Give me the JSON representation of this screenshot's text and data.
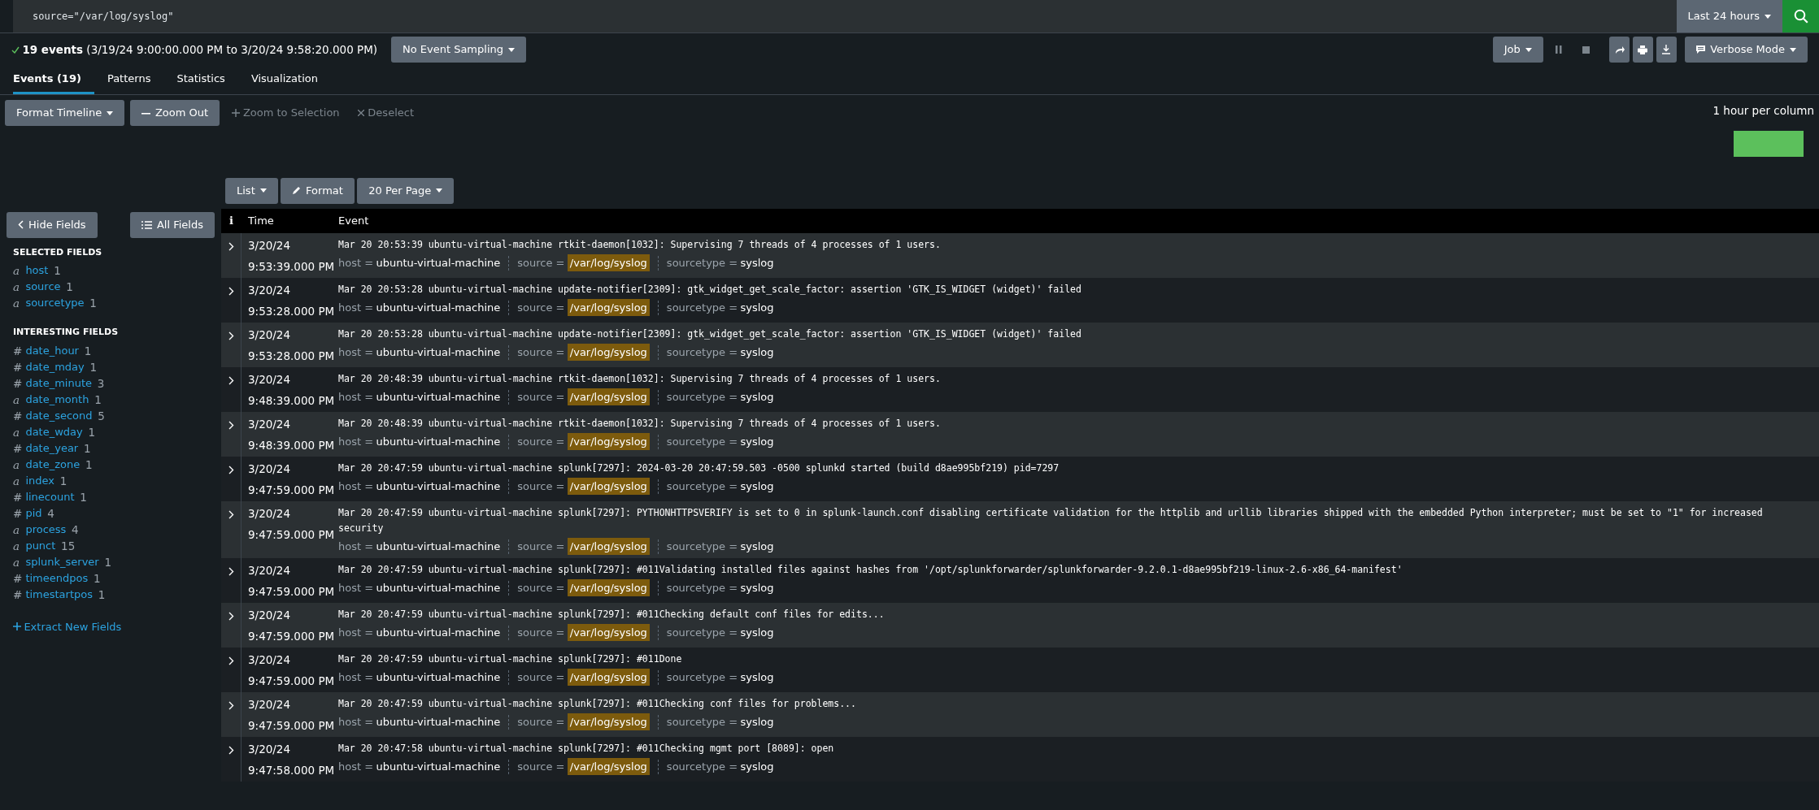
{
  "search": {
    "query": "source=\"/var/log/syslog\"",
    "time_range": "Last 24 hours"
  },
  "summary": {
    "count": "19 events",
    "range": "(3/19/24 9:00:00.000 PM to 3/20/24 9:58:20.000 PM)",
    "sampling": "No Event Sampling"
  },
  "job": {
    "label": "Job",
    "mode": "Verbose Mode"
  },
  "tabs": [
    {
      "label": "Events (19)",
      "selected": true
    },
    {
      "label": "Patterns",
      "selected": false
    },
    {
      "label": "Statistics",
      "selected": false
    },
    {
      "label": "Visualization",
      "selected": false
    }
  ],
  "timeline": {
    "buttons": [
      {
        "label": "Format Timeline",
        "kind": "dropdown",
        "disabled": false
      },
      {
        "label": "Zoom Out",
        "kind": "minus",
        "disabled": false
      },
      {
        "label": "Zoom to Selection",
        "kind": "plus",
        "disabled": true
      },
      {
        "label": "Deselect",
        "kind": "cross",
        "disabled": true
      }
    ],
    "scale": "1 hour per column"
  },
  "results_toolbar": [
    {
      "label": "List",
      "kind": "dropdown"
    },
    {
      "label": "Format",
      "kind": "pencil"
    },
    {
      "label": "20 Per Page",
      "kind": "dropdown"
    }
  ],
  "sidebar": {
    "hide_fields": "Hide Fields",
    "all_fields": "All Fields",
    "sections": [
      {
        "heading": "SELECTED FIELDS",
        "fields": [
          {
            "type": "a",
            "name": "host",
            "count": "1"
          },
          {
            "type": "a",
            "name": "source",
            "count": "1"
          },
          {
            "type": "a",
            "name": "sourcetype",
            "count": "1"
          }
        ]
      },
      {
        "heading": "INTERESTING FIELDS",
        "fields": [
          {
            "type": "#",
            "name": "date_hour",
            "count": "1"
          },
          {
            "type": "#",
            "name": "date_mday",
            "count": "1"
          },
          {
            "type": "#",
            "name": "date_minute",
            "count": "3"
          },
          {
            "type": "a",
            "name": "date_month",
            "count": "1"
          },
          {
            "type": "#",
            "name": "date_second",
            "count": "5"
          },
          {
            "type": "a",
            "name": "date_wday",
            "count": "1"
          },
          {
            "type": "#",
            "name": "date_year",
            "count": "1"
          },
          {
            "type": "a",
            "name": "date_zone",
            "count": "1"
          },
          {
            "type": "a",
            "name": "index",
            "count": "1"
          },
          {
            "type": "#",
            "name": "linecount",
            "count": "1"
          },
          {
            "type": "#",
            "name": "pid",
            "count": "4"
          },
          {
            "type": "a",
            "name": "process",
            "count": "4"
          },
          {
            "type": "a",
            "name": "punct",
            "count": "15"
          },
          {
            "type": "a",
            "name": "splunk_server",
            "count": "1"
          },
          {
            "type": "#",
            "name": "timeendpos",
            "count": "1"
          },
          {
            "type": "#",
            "name": "timestartpos",
            "count": "1"
          }
        ]
      }
    ],
    "extract": "Extract New Fields"
  },
  "table": {
    "columns": [
      "i",
      "Time",
      "Event"
    ],
    "rows": [
      {
        "date": "3/20/24",
        "time": "9:53:39.000 PM",
        "event": "Mar 20 20:53:39 ubuntu-virtual-machine rtkit-daemon[1032]: Supervising 7 threads of 4 processes of 1 users.",
        "fields": [
          {
            "label": "host =",
            "value": "ubuntu-virtual-machine",
            "highlighted": false
          },
          {
            "label": "source =",
            "value": "/var/log/syslog",
            "highlighted": true
          },
          {
            "label": "sourcetype =",
            "value": "syslog",
            "highlighted": false
          }
        ]
      },
      {
        "date": "3/20/24",
        "time": "9:53:28.000 PM",
        "event": "Mar 20 20:53:28 ubuntu-virtual-machine update-notifier[2309]: gtk_widget_get_scale_factor: assertion 'GTK_IS_WIDGET (widget)' failed",
        "fields": [
          {
            "label": "host =",
            "value": "ubuntu-virtual-machine",
            "highlighted": false
          },
          {
            "label": "source =",
            "value": "/var/log/syslog",
            "highlighted": true
          },
          {
            "label": "sourcetype =",
            "value": "syslog",
            "highlighted": false
          }
        ]
      },
      {
        "date": "3/20/24",
        "time": "9:53:28.000 PM",
        "event": "Mar 20 20:53:28 ubuntu-virtual-machine update-notifier[2309]: gtk_widget_get_scale_factor: assertion 'GTK_IS_WIDGET (widget)' failed",
        "fields": [
          {
            "label": "host =",
            "value": "ubuntu-virtual-machine",
            "highlighted": false
          },
          {
            "label": "source =",
            "value": "/var/log/syslog",
            "highlighted": true
          },
          {
            "label": "sourcetype =",
            "value": "syslog",
            "highlighted": false
          }
        ]
      },
      {
        "date": "3/20/24",
        "time": "9:48:39.000 PM",
        "event": "Mar 20 20:48:39 ubuntu-virtual-machine rtkit-daemon[1032]: Supervising 7 threads of 4 processes of 1 users.",
        "fields": [
          {
            "label": "host =",
            "value": "ubuntu-virtual-machine",
            "highlighted": false
          },
          {
            "label": "source =",
            "value": "/var/log/syslog",
            "highlighted": true
          },
          {
            "label": "sourcetype =",
            "value": "syslog",
            "highlighted": false
          }
        ]
      },
      {
        "date": "3/20/24",
        "time": "9:48:39.000 PM",
        "event": "Mar 20 20:48:39 ubuntu-virtual-machine rtkit-daemon[1032]: Supervising 7 threads of 4 processes of 1 users.",
        "fields": [
          {
            "label": "host =",
            "value": "ubuntu-virtual-machine",
            "highlighted": false
          },
          {
            "label": "source =",
            "value": "/var/log/syslog",
            "highlighted": true
          },
          {
            "label": "sourcetype =",
            "value": "syslog",
            "highlighted": false
          }
        ]
      },
      {
        "date": "3/20/24",
        "time": "9:47:59.000 PM",
        "event": "Mar 20 20:47:59 ubuntu-virtual-machine splunk[7297]: 2024-03-20 20:47:59.503 -0500 splunkd started (build d8ae995bf219) pid=7297",
        "fields": [
          {
            "label": "host =",
            "value": "ubuntu-virtual-machine",
            "highlighted": false
          },
          {
            "label": "source =",
            "value": "/var/log/syslog",
            "highlighted": true
          },
          {
            "label": "sourcetype =",
            "value": "syslog",
            "highlighted": false
          }
        ]
      },
      {
        "date": "3/20/24",
        "time": "9:47:59.000 PM",
        "event": "Mar 20 20:47:59 ubuntu-virtual-machine splunk[7297]: PYTHONHTTPSVERIFY is set to 0 in splunk-launch.conf disabling certificate validation for the httplib and urllib libraries shipped with the embedded Python interpreter; must be set to \"1\" for increased security",
        "fields": [
          {
            "label": "host =",
            "value": "ubuntu-virtual-machine",
            "highlighted": false
          },
          {
            "label": "source =",
            "value": "/var/log/syslog",
            "highlighted": true
          },
          {
            "label": "sourcetype =",
            "value": "syslog",
            "highlighted": false
          }
        ]
      },
      {
        "date": "3/20/24",
        "time": "9:47:59.000 PM",
        "event": "Mar 20 20:47:59 ubuntu-virtual-machine splunk[7297]: #011Validating installed files against hashes from '/opt/splunkforwarder/splunkforwarder-9.2.0.1-d8ae995bf219-linux-2.6-x86_64-manifest'",
        "fields": [
          {
            "label": "host =",
            "value": "ubuntu-virtual-machine",
            "highlighted": false
          },
          {
            "label": "source =",
            "value": "/var/log/syslog",
            "highlighted": true
          },
          {
            "label": "sourcetype =",
            "value": "syslog",
            "highlighted": false
          }
        ]
      },
      {
        "date": "3/20/24",
        "time": "9:47:59.000 PM",
        "event": "Mar 20 20:47:59 ubuntu-virtual-machine splunk[7297]: #011Checking default conf files for edits...",
        "fields": [
          {
            "label": "host =",
            "value": "ubuntu-virtual-machine",
            "highlighted": false
          },
          {
            "label": "source =",
            "value": "/var/log/syslog",
            "highlighted": true
          },
          {
            "label": "sourcetype =",
            "value": "syslog",
            "highlighted": false
          }
        ]
      },
      {
        "date": "3/20/24",
        "time": "9:47:59.000 PM",
        "event": "Mar 20 20:47:59 ubuntu-virtual-machine splunk[7297]: #011Done",
        "fields": [
          {
            "label": "host =",
            "value": "ubuntu-virtual-machine",
            "highlighted": false
          },
          {
            "label": "source =",
            "value": "/var/log/syslog",
            "highlighted": true
          },
          {
            "label": "sourcetype =",
            "value": "syslog",
            "highlighted": false
          }
        ]
      },
      {
        "date": "3/20/24",
        "time": "9:47:59.000 PM",
        "event": "Mar 20 20:47:59 ubuntu-virtual-machine splunk[7297]: #011Checking conf files for problems...",
        "fields": [
          {
            "label": "host =",
            "value": "ubuntu-virtual-machine",
            "highlighted": false
          },
          {
            "label": "source =",
            "value": "/var/log/syslog",
            "highlighted": true
          },
          {
            "label": "sourcetype =",
            "value": "syslog",
            "highlighted": false
          }
        ]
      },
      {
        "date": "3/20/24",
        "time": "9:47:58.000 PM",
        "event": "Mar 20 20:47:58 ubuntu-virtual-machine splunk[7297]: #011Checking mgmt port [8089]: open",
        "fields": [
          {
            "label": "host =",
            "value": "ubuntu-virtual-machine",
            "highlighted": false
          },
          {
            "label": "source =",
            "value": "/var/log/syslog",
            "highlighted": true
          },
          {
            "label": "sourcetype =",
            "value": "syslog",
            "highlighted": false
          }
        ]
      }
    ]
  }
}
